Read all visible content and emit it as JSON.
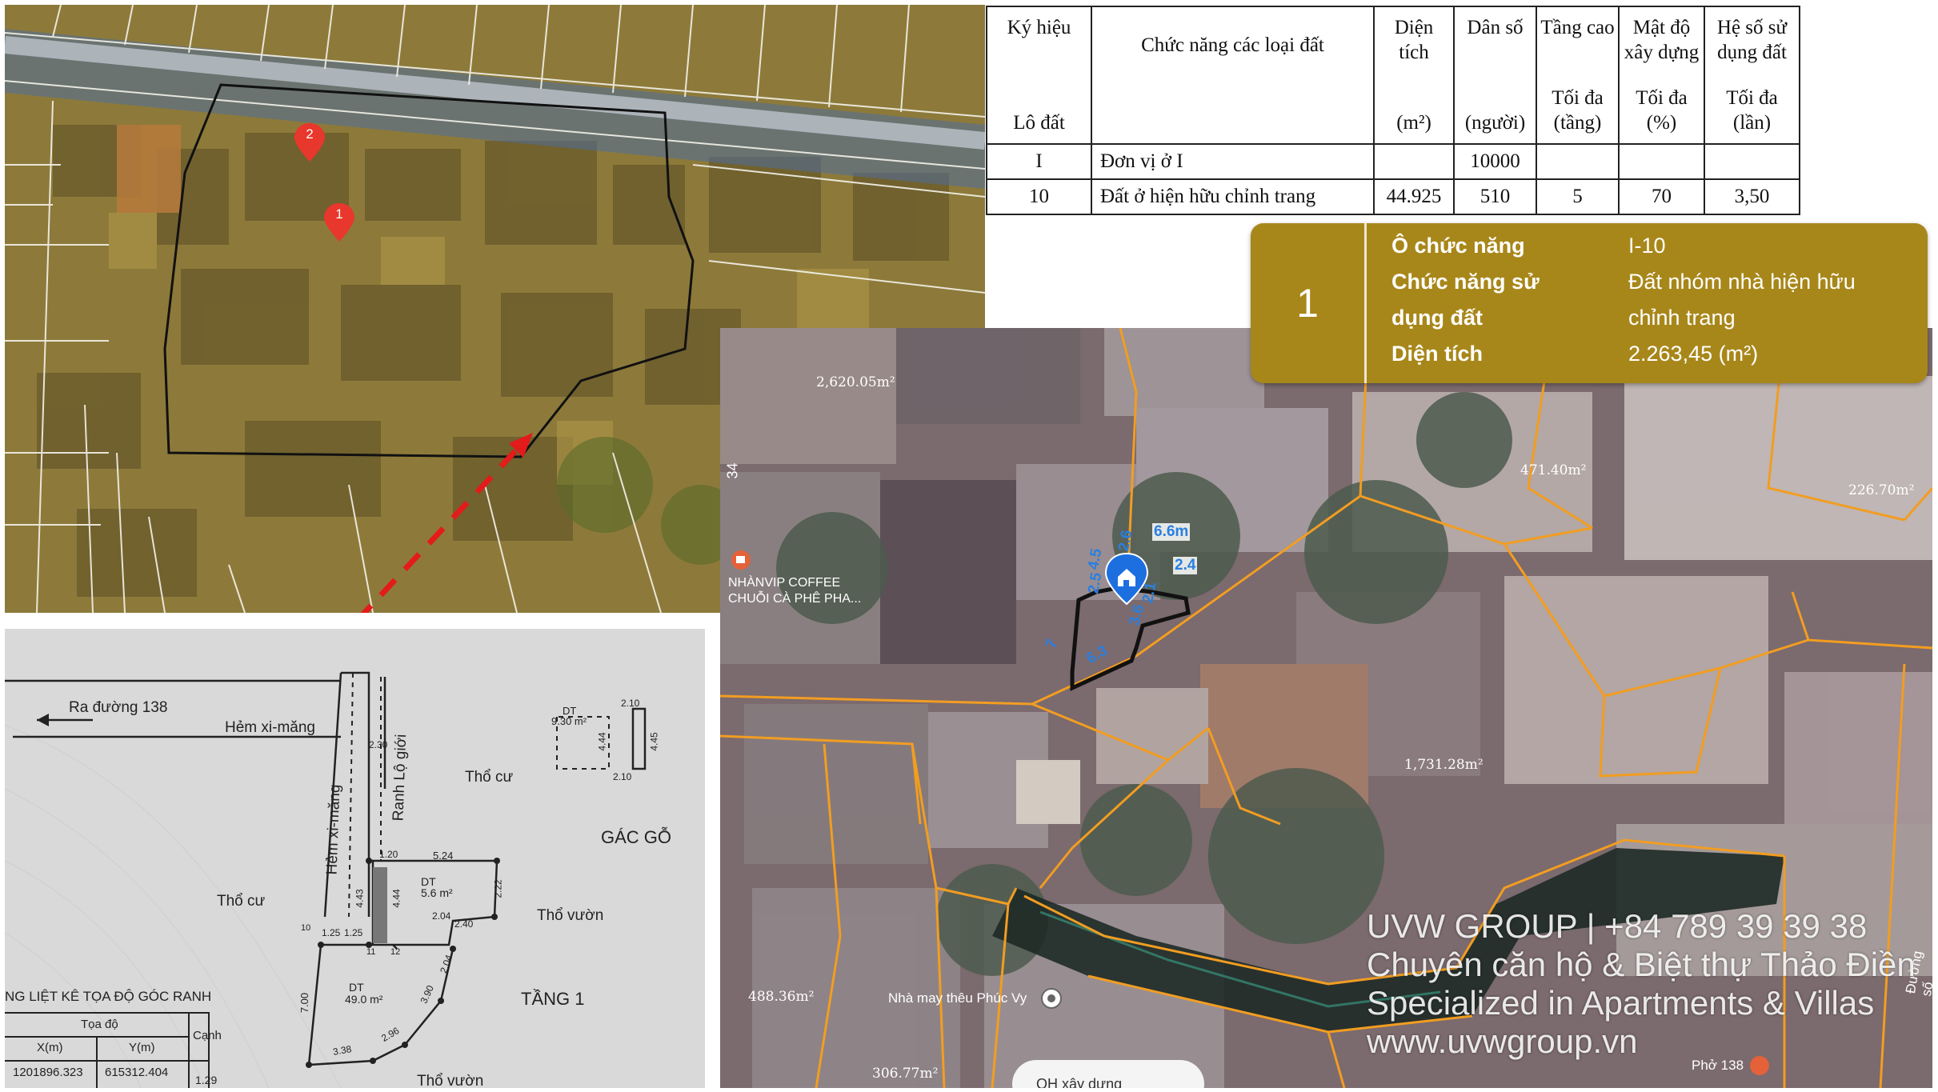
{
  "table": {
    "headers": {
      "col1_top": "Ký hiệu",
      "col1_bottom": "Lô đất",
      "col2": "Chức năng các loại đất",
      "col3_top": "Diện tích",
      "col3_unit": "(m²)",
      "col4_top": "Dân số",
      "col4_unit": "(người)",
      "col5_top": "Tầng cao",
      "col5_bottom": "Tối đa (tầng)",
      "col6_top": "Mật độ xây dựng",
      "col6_bottom": "Tối đa (%)",
      "col7_top": "Hệ số sử dụng đất",
      "col7_bottom": "Tối đa (lần)"
    },
    "rows": [
      {
        "code": "I",
        "function": "Đơn vị ở I",
        "area": "",
        "population": "10000",
        "floors": "",
        "density": "",
        "far": ""
      },
      {
        "code": "10",
        "function": "Đất ở hiện hữu chỉnh trang",
        "area": "44.925",
        "population": "510",
        "floors": "5",
        "density": "70",
        "far": "3,50"
      }
    ]
  },
  "info_card": {
    "number": "1",
    "label_1": "Ô chức năng",
    "value_1": "I-10",
    "label_2a": "Chức năng sử",
    "label_2b": "dụng đất",
    "value_2a": "Đất nhóm nhà hiện hữu",
    "value_2b": "chỉnh trang",
    "label_3": "Diện tích",
    "value_3": "2.263,45 (m²)"
  },
  "topleft_map": {
    "pin_1": "1",
    "pin_2": "2"
  },
  "satellite_map": {
    "areas": [
      "2,620.05m²",
      "471.40m²",
      "226.70m²",
      "1,731.28m²",
      "488.36m²",
      "306.77m²"
    ],
    "street_number": "34",
    "poi_cafe_line1": "NHÀNVIP COFFEE",
    "poi_cafe_line2": "CHUỖI CÀ PHÊ PHA...",
    "poi_factory": "Nhà may thêu Phúc Vy",
    "poi_pho": "Phở 138",
    "road_label": "Đường số",
    "bottom_pill": "QH xây dựng",
    "dims": [
      "6.6m",
      "2.6",
      "4.5",
      "2.5",
      "2.4",
      "2.1",
      "3.6",
      "6.3",
      "7"
    ],
    "colors": {
      "parcel_outline": "#f29d21",
      "highlight": "#111111",
      "pin": "#1d6fe0"
    }
  },
  "sketch": {
    "road_to": "Ra đường 138",
    "alley": "Hẻm xi-măng",
    "alley_vertical": "Hẻm xi-măng",
    "ditch": "Ranh Lộ giới",
    "tho_cu_1": "Thổ cư",
    "tho_cu_2": "Thổ cư",
    "tho_vuon_1": "Thổ vườn",
    "tho_vuon_2": "Thổ vườn",
    "gac_go": "GÁC GỖ",
    "tang_1": "TẦNG 1",
    "dt_attic": "DT",
    "dt_attic_val": "9.30 m²",
    "dt_small": "DT",
    "dt_small_val": "5.6 m²",
    "dt_main": "DT",
    "dt_main_val": "49.0 m²",
    "dims": [
      "2.10",
      "4.44",
      "4.45",
      "2.10",
      "2.30",
      "1.20",
      "5.24",
      "4.43",
      "4.44",
      "2.22",
      "1.25",
      "1.25",
      "2.04",
      "2.40",
      "2.04",
      "3.90",
      "7.00",
      "2.96",
      "3.38"
    ],
    "points": [
      "10",
      "11",
      "12"
    ],
    "coord_title": "NG LIỆT KÊ TỌA ĐỘ GÓC RANH",
    "coord_header": "Tọa độ",
    "col_x": "X(m)",
    "col_y": "Y(m)",
    "col_edge": "Cạnh",
    "coord_x": "1201896.323",
    "coord_y": "615312.404",
    "edge_val": "1.29"
  },
  "watermark": {
    "line1": "UVW GROUP | +84 789 39 39 38",
    "line2": "Chuyên căn hộ & Biệt thự Thảo Điền",
    "line3": "Specialized in Apartments & Villas",
    "line4": "www.uvwgroup.vn"
  }
}
